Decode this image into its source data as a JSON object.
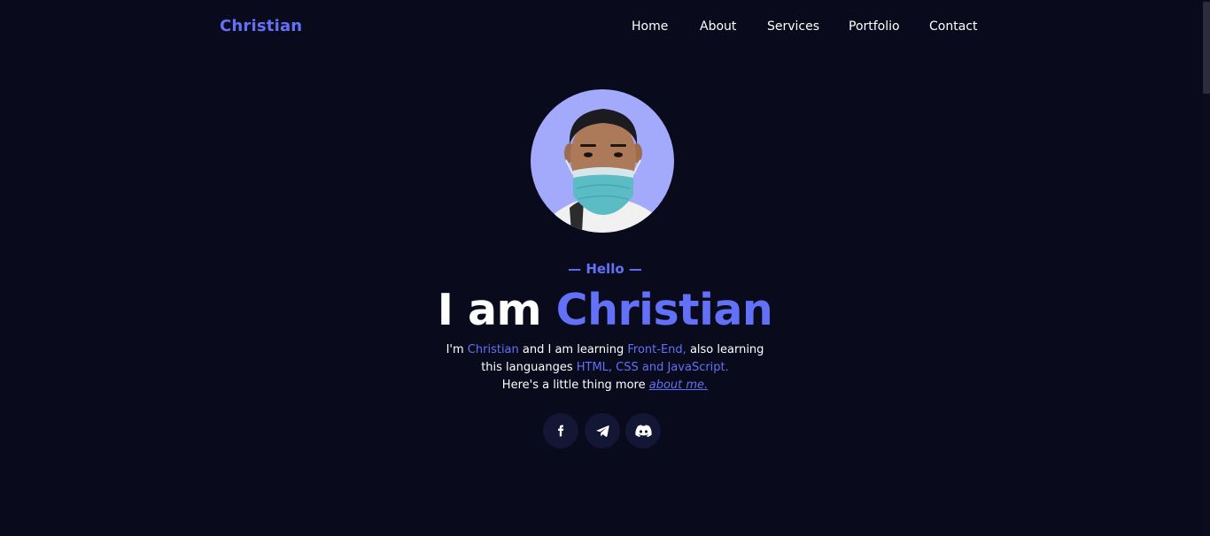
{
  "header": {
    "logo": "Christian",
    "nav": [
      "Home",
      "About",
      "Services",
      "Portfolio",
      "Contact"
    ]
  },
  "hero": {
    "greeting": "— Hello —",
    "headline_prefix": "I am ",
    "headline_name": "Christian",
    "desc": {
      "p1": "I'm ",
      "name": "Christian",
      "p2": " and I am learning ",
      "field": "Front-End,",
      "p3": " also learning",
      "p4": "this languanges ",
      "langs": "HTML, CSS and JavaScript.",
      "p5": "Here's a little thing more ",
      "link": "about me."
    },
    "socials": [
      "facebook-icon",
      "telegram-icon",
      "discord-icon"
    ]
  },
  "colors": {
    "background": "#090a1b",
    "accent": "#6271f7",
    "avatar_bg": "#a3aafc",
    "social_bg": "#131634"
  }
}
